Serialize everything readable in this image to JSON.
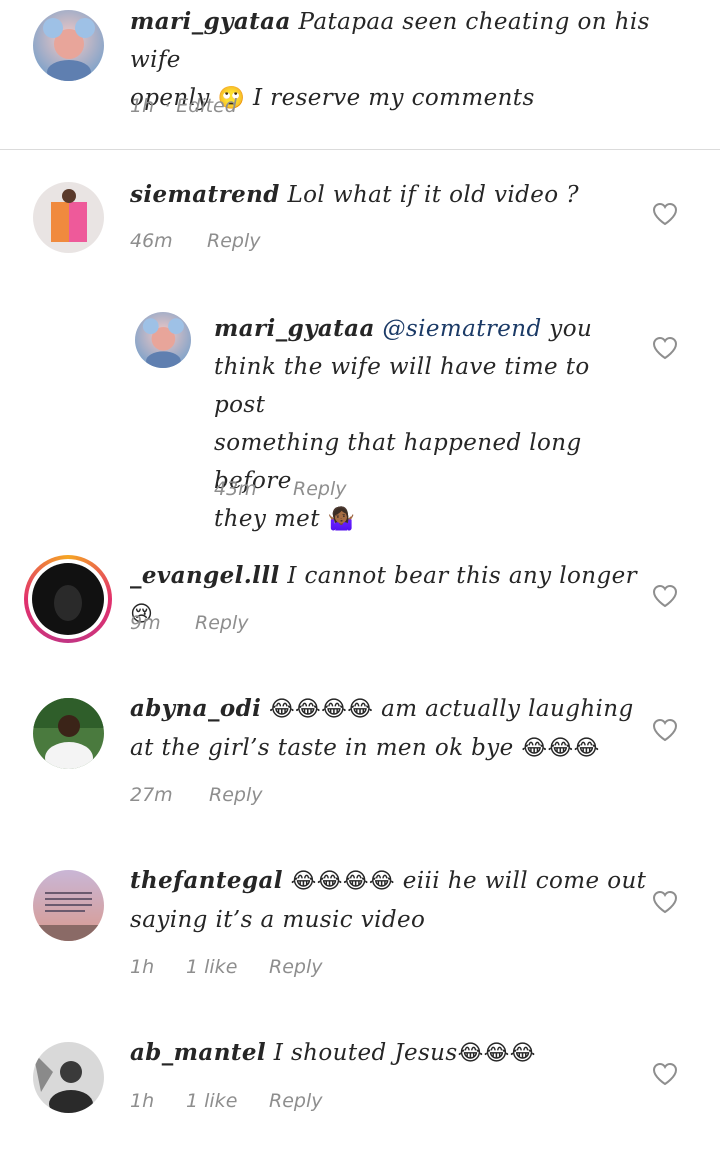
{
  "caption": {
    "username": "mari_gyataa",
    "text_line1": "Patapaa seen cheating on his wife",
    "text_line2a": "openly",
    "text_line2b": "I reserve my comments",
    "emoji": "🙄",
    "time": "1h",
    "edited": "· Edited"
  },
  "comments": [
    {
      "username": "siematrend",
      "text": "Lol what if it old video ?",
      "time": "46m",
      "reply": "Reply"
    },
    {
      "username": "mari_gyataa",
      "mention": "@siematrend",
      "line1_tail": "you",
      "line2": "think the wife will have time to post",
      "line3": "something that happened long before",
      "line4": "they met",
      "emoji": "🤷🏾‍♀️",
      "time": "43m",
      "reply": "Reply"
    },
    {
      "username": "_evangel.lll",
      "text": "I cannot bear this any longer",
      "emoji": "😢",
      "time": "9m",
      "reply": "Reply"
    },
    {
      "username": "abyna_odi",
      "emoji_lead": "😂😂😂😂",
      "line1": "am actually laughing",
      "line2": "at the girl’s taste in men ok bye",
      "emoji_tail": "😂😂😂",
      "time": "27m",
      "reply": "Reply"
    },
    {
      "username": "thefantegal",
      "emoji_lead": "😂😂😂😂",
      "line1": "eiii he will come out",
      "line2": "saying it’s a music video",
      "time": "1h",
      "likes": "1 like",
      "reply": "Reply"
    },
    {
      "username": "ab_mantel",
      "text": "I shouted Jesus",
      "emoji": "😂😂😂",
      "time": "1h",
      "likes": "1 like",
      "reply": "Reply"
    }
  ],
  "colors": {
    "text": "#262626",
    "muted": "#8e8e8e",
    "mention": "#1b3a66",
    "divider": "#dbdbdb"
  },
  "icons": {
    "like": "heart-outline-icon"
  }
}
